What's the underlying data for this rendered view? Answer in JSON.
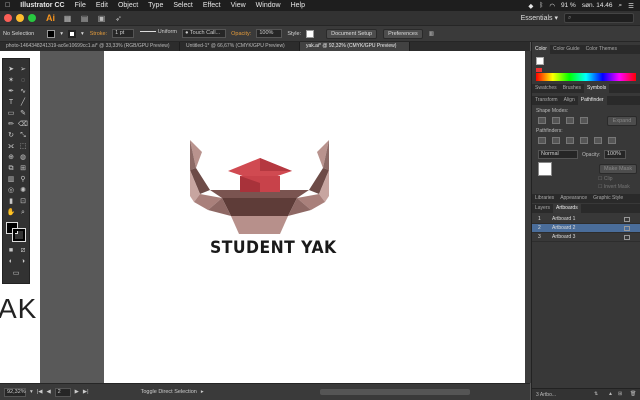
{
  "menubar": {
    "apple": "",
    "app_name": "Illustrator CC",
    "items": [
      "File",
      "Edit",
      "Object",
      "Type",
      "Select",
      "Effect",
      "View",
      "Window",
      "Help"
    ],
    "battery": "91 %",
    "clock": "søn. 14.46"
  },
  "appbar": {
    "logo": "Ai",
    "workspace": "Essentials",
    "workspace_arrow": "▾"
  },
  "control_bar": {
    "selection": "No Selection",
    "stroke_label": "Stroke:",
    "stroke_value": "1 pt",
    "profile_value": "Uniform",
    "brush_value": "Touch Call...",
    "opacity_label": "Opacity:",
    "opacity_value": "100%",
    "style_label": "Style:",
    "document_setup": "Document Setup",
    "preferences": "Preferences"
  },
  "doc_tabs": [
    {
      "label": "photo-1464348241319-ac6e10699cc1.ai* @ 33,33% (RGB/GPU Preview)",
      "active": false
    },
    {
      "label": "Untitled-1* @ 66,67% (CMYK/GPU Preview)",
      "active": false
    },
    {
      "label": "yak.ai* @ 92,32% (CMYK/GPU Preview)",
      "active": true
    }
  ],
  "canvas": {
    "logo_text": "STUDENT YAK",
    "left_artboard_text": "AK"
  },
  "status_bar": {
    "zoom": "92,32%",
    "page": "2",
    "tool_hint": "Toggle Direct Selection"
  },
  "panels": {
    "color_tabs": [
      "Color",
      "Color Guide",
      "Color Themes"
    ],
    "swatch_tabs": [
      "Swatches",
      "Brushes",
      "Symbols"
    ],
    "transform_tabs": [
      "Transform",
      "Align",
      "Pathfinder"
    ],
    "shape_modes_label": "Shape Modes:",
    "expand_label": "Expand",
    "pathfinders_label": "Pathfinders:",
    "blend_mode": "Normal",
    "transparency_opacity_label": "Opacity:",
    "transparency_opacity": "100%",
    "make_mask": "Make Mask",
    "clip_label": "Clip",
    "invert_mask_label": "Invert Mask",
    "library_tabs": [
      "Libraries",
      "Appearance",
      "Graphic Style"
    ],
    "layer_tabs": [
      "Layers",
      "Artboards"
    ],
    "artboards": [
      {
        "num": "1",
        "name": "Artboard 1",
        "selected": false
      },
      {
        "num": "2",
        "name": "Artboard 2",
        "selected": true
      },
      {
        "num": "3",
        "name": "Artboard 3",
        "selected": false
      }
    ],
    "artboards_footer": "3 Artbo..."
  },
  "colors": {
    "accent": "#f7941e",
    "selection": "#4a6d9a",
    "logo_dark": "#5a3a36",
    "logo_red": "#c8424a"
  }
}
